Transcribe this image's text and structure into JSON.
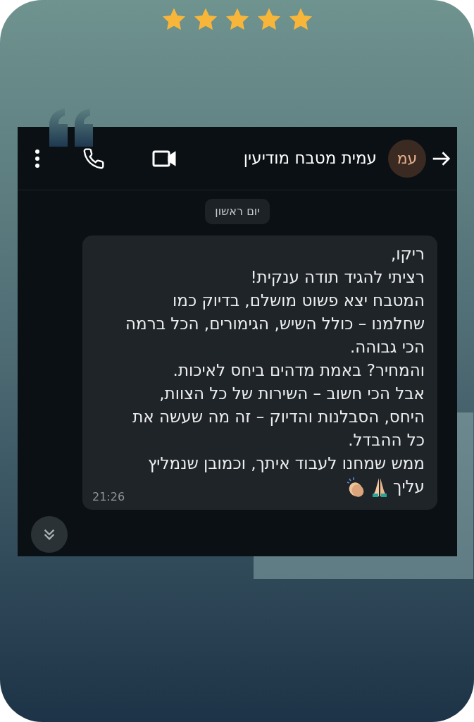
{
  "rating": {
    "stars": 5
  },
  "chat": {
    "contact_name": "עמית מטבח מודיעין",
    "avatar_initials": "עמ",
    "date_chip": "יום ראשון",
    "message": {
      "lines": [
        "ריקו,",
        "רציתי להגיד תודה ענקית!",
        "המטבח יצא פשוט מושלם, בדיוק כמו",
        "שחלמנו – כולל השיש, הגימורים, הכל ברמה",
        "הכי גבוהה.",
        "והמחיר? באמת מדהים ביחס לאיכות.",
        "אבל הכי חשוב – השירות של כל הצוות,",
        "היחס, הסבלנות והדיוק – זה מה שעשה את",
        "כל ההבדל.",
        "ממש שמחנו לעבוד איתך, וכמובן שנמליץ",
        "עליך"
      ],
      "time": "21:26"
    }
  }
}
